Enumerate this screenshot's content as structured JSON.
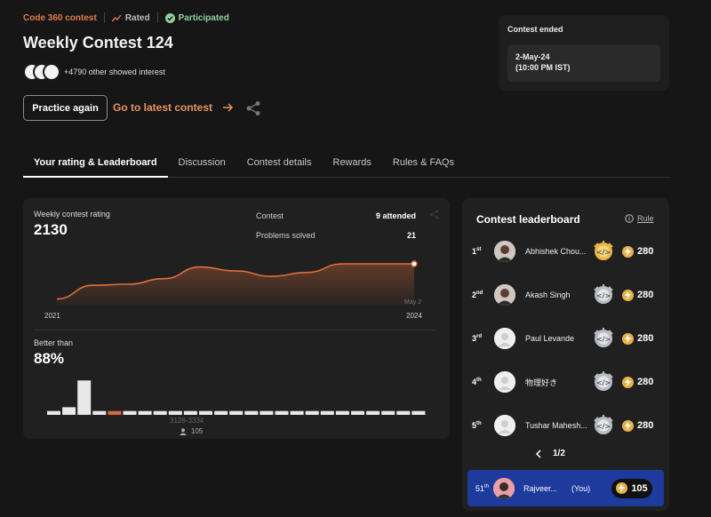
{
  "contest": {
    "series": "Code 360 contest",
    "rated": "Rated",
    "participated": "Participated",
    "title": "Weekly Contest 124",
    "interest": "+4790 other showed interest",
    "practice_label": "Practice again",
    "latest_label": "Go to latest contest"
  },
  "ended": {
    "label": "Contest ended",
    "date": "2-May-24",
    "time": "(10:00 PM IST)"
  },
  "tabs": [
    {
      "label": "Your rating & Leaderboard"
    },
    {
      "label": "Discussion"
    },
    {
      "label": "Contest details"
    },
    {
      "label": "Rewards"
    },
    {
      "label": "Rules & FAQs"
    }
  ],
  "rating": {
    "label": "Weekly contest rating",
    "value": "2130",
    "contest_label": "Contest",
    "contest_value": "9 attended",
    "problems_label": "Problems solved",
    "problems_value": "21",
    "x_start": "2021",
    "x_end": "2024",
    "point_label": "May 2",
    "better_label": "Better than",
    "better_value": "88%",
    "range_label": "3128-3334",
    "count_label": "105"
  },
  "chart_data": [
    {
      "type": "area",
      "x": [
        "2021",
        "",
        "",
        "",
        "",
        "",
        "",
        "",
        "",
        "",
        "2024"
      ],
      "values": [
        0.1,
        0.45,
        0.48,
        0.62,
        0.92,
        0.82,
        0.68,
        0.78,
        1.0,
        1.0,
        1.0
      ],
      "color": "#e06e3c",
      "point_label": "May 2"
    },
    {
      "type": "bar",
      "values": [
        1,
        2,
        9,
        1,
        1,
        1,
        1,
        1,
        1,
        1,
        1,
        1,
        1,
        1,
        1,
        1,
        1,
        1,
        1,
        1,
        1,
        1,
        1,
        1,
        1
      ],
      "highlight_index": 4,
      "highlight_color": "#d9663a",
      "range_label": "3128-3334",
      "count_label": "105"
    }
  ],
  "leaderboard": {
    "title": "Contest leaderboard",
    "rule": "Rule",
    "rows": [
      {
        "rank": "1",
        "suffix": "st",
        "name": "Abhishek Chou...",
        "score": "280",
        "badge": "gold"
      },
      {
        "rank": "2",
        "suffix": "nd",
        "name": "Akash Singh",
        "score": "280",
        "badge": "silver"
      },
      {
        "rank": "3",
        "suffix": "rd",
        "name": "Paul Levande",
        "score": "280",
        "badge": "silver"
      },
      {
        "rank": "4",
        "suffix": "th",
        "name": "物理好き",
        "score": "280",
        "badge": "silver"
      },
      {
        "rank": "5",
        "suffix": "th",
        "name": "Tushar Mahesh...",
        "score": "280",
        "badge": "silver"
      }
    ],
    "page": "1/2",
    "you": {
      "rank": "51",
      "suffix": "th",
      "name": "Rajveer...",
      "tag": "(You)",
      "score": "105"
    }
  }
}
